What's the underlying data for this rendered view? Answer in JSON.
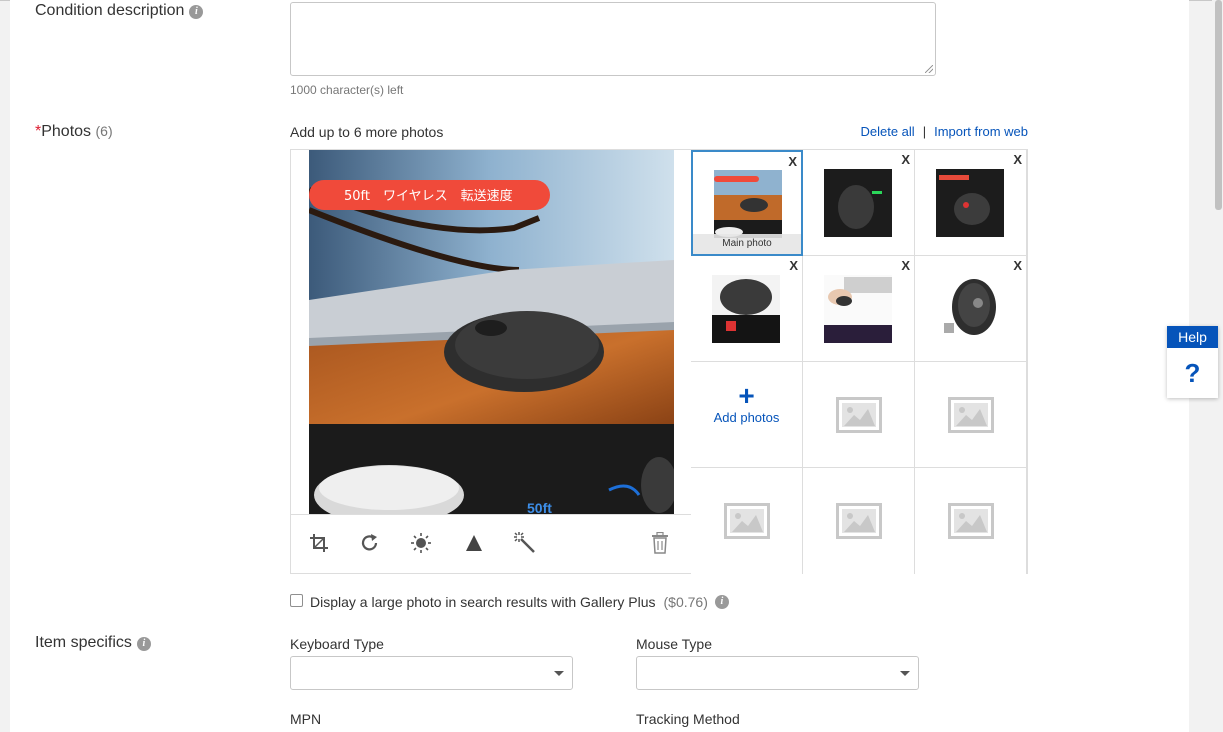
{
  "condition": {
    "label": "Condition description",
    "value": "",
    "chars_left": "1000 character(s) left"
  },
  "photos": {
    "label": "Photos",
    "required_mark": "*",
    "count": "(6)",
    "add_text": "Add up to 6 more photos",
    "delete_all": "Delete all",
    "separator": "|",
    "import_web": "Import from web",
    "main_label": "Main photo",
    "remove_label": "X",
    "add_photos_plus": "+",
    "add_photos": "Add photos",
    "big_photo_banner": "50ft　ワイヤレス　転送速度",
    "big_photo_badge": "50ft"
  },
  "gallery": {
    "label": "Display a large photo in search results with Gallery Plus",
    "price": "($0.76)",
    "checked": false
  },
  "specifics": {
    "label": "Item specifics",
    "keyboard_type": "Keyboard Type",
    "mouse_type": "Mouse Type",
    "mpn": "MPN",
    "tracking_method": "Tracking Method"
  },
  "help": {
    "label": "Help",
    "icon": "?"
  },
  "colors": {
    "link": "#0654ba",
    "required": "#dd1e31",
    "main_border": "#3a8ac9",
    "banner": "#f04a3a"
  }
}
